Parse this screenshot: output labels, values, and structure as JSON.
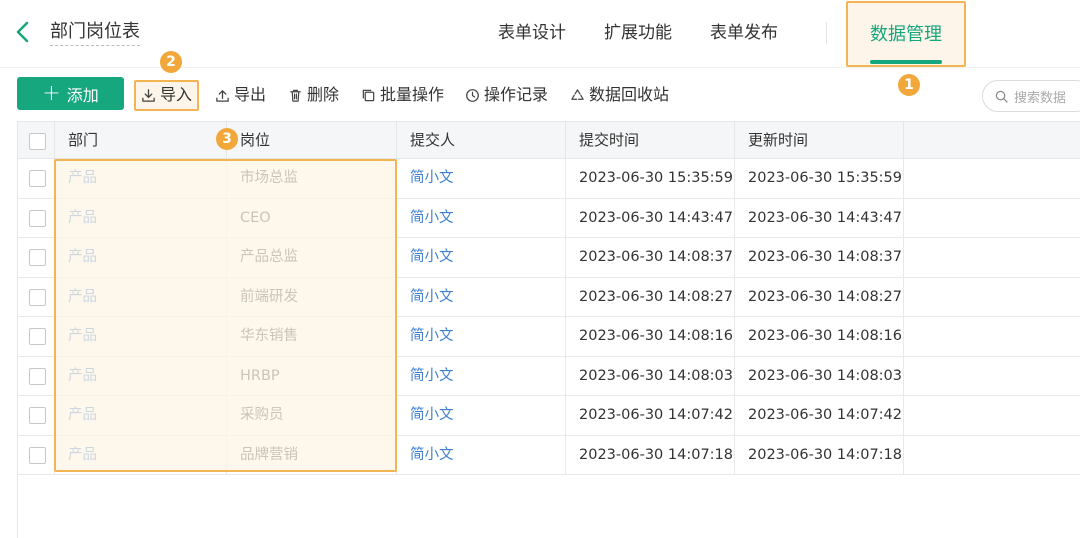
{
  "header": {
    "title": "部门岗位表",
    "tabs": [
      {
        "label": "表单设计"
      },
      {
        "label": "扩展功能"
      },
      {
        "label": "表单发布"
      },
      {
        "label": "数据管理"
      }
    ]
  },
  "badges": {
    "one": "1",
    "two": "2",
    "three": "3"
  },
  "toolbar": {
    "add": "添加",
    "import": "导入",
    "export": "导出",
    "delete": "删除",
    "batch": "批量操作",
    "log": "操作记录",
    "recycle": "数据回收站",
    "search_placeholder": "搜索数据"
  },
  "table": {
    "headers": [
      "部门",
      "岗位",
      "提交人",
      "提交时间",
      "更新时间"
    ],
    "rows": [
      {
        "dept": "产品",
        "position": "市场总监",
        "submitter": "简小文",
        "submit_time": "2023-06-30 15:35:59",
        "update_time": "2023-06-30 15:35:59"
      },
      {
        "dept": "产品",
        "position": "CEO",
        "submitter": "简小文",
        "submit_time": "2023-06-30 14:43:47",
        "update_time": "2023-06-30 14:43:47"
      },
      {
        "dept": "产品",
        "position": "产品总监",
        "submitter": "简小文",
        "submit_time": "2023-06-30 14:08:37",
        "update_time": "2023-06-30 14:08:37"
      },
      {
        "dept": "产品",
        "position": "前端研发",
        "submitter": "简小文",
        "submit_time": "2023-06-30 14:08:27",
        "update_time": "2023-06-30 14:08:27"
      },
      {
        "dept": "产品",
        "position": "华东销售",
        "submitter": "简小文",
        "submit_time": "2023-06-30 14:08:16",
        "update_time": "2023-06-30 14:08:16"
      },
      {
        "dept": "产品",
        "position": "HRBP",
        "submitter": "简小文",
        "submit_time": "2023-06-30 14:08:03",
        "update_time": "2023-06-30 14:08:03"
      },
      {
        "dept": "产品",
        "position": "采购员",
        "submitter": "简小文",
        "submit_time": "2023-06-30 14:07:42",
        "update_time": "2023-06-30 14:07:42"
      },
      {
        "dept": "产品",
        "position": "品牌营销",
        "submitter": "简小文",
        "submit_time": "2023-06-30 14:07:18",
        "update_time": "2023-06-30 14:07:18"
      }
    ]
  },
  "colors": {
    "accent": "#16a77e",
    "highlight": "#f3b554",
    "link": "#3d7fd1"
  }
}
